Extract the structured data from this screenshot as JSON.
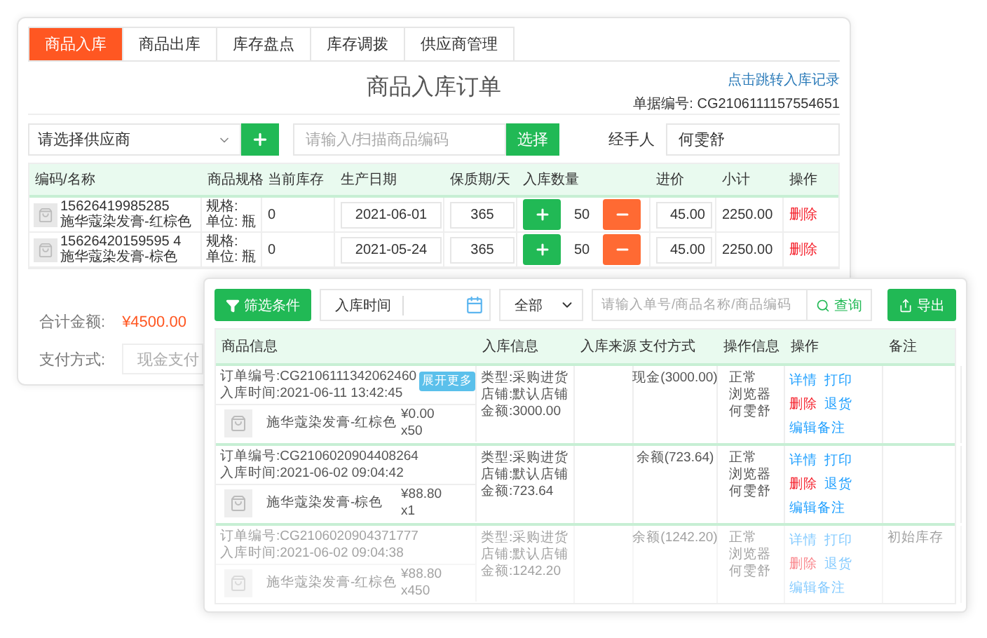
{
  "inbound_panel": {
    "tabs": [
      {
        "label": "商品入库",
        "selected": true
      },
      {
        "label": "商品出库",
        "selected": false
      },
      {
        "label": "库存盘点",
        "selected": false
      },
      {
        "label": "库存调拨",
        "selected": false
      },
      {
        "label": "供应商管理",
        "selected": false
      }
    ],
    "title": "商品入库订单",
    "record_link": "点击跳转入库记录",
    "order_no": "单据编号: CG2106111157554651",
    "supplier_select": "请选择供应商",
    "code_field": {
      "placeholder": "请输入/扫描商品编码"
    },
    "select_button": "选择",
    "handler_label": "经手人",
    "handler_value": "何雯舒",
    "columns": [
      "编码/名称",
      "商品规格",
      "当前库存",
      "生产日期",
      "保质期/天",
      "入库数量",
      "进价",
      "小计",
      "操作"
    ],
    "rows": [
      {
        "code": "15626419985285",
        "name": "施华蔻染发膏-红棕色",
        "spec": "规格:",
        "unit": "单位:  瓶",
        "stock": "0",
        "date": "2021-06-01",
        "shelf_life": "365",
        "quantity": "50",
        "price": "45.00",
        "subtotal": "2250.00",
        "action": "删除"
      },
      {
        "code": "15626420159595 4",
        "name": "施华蔻染发膏-棕色",
        "spec": "规格:",
        "unit": "单位:  瓶",
        "stock": "0",
        "date": "2021-05-24",
        "shelf_life": "365",
        "quantity": "50",
        "price": "45.00",
        "subtotal": "2250.00",
        "action": "删除"
      }
    ],
    "total_label": "合计金额:",
    "total": "¥4500.00",
    "payment_label": "支付方式:",
    "payment_value": "现金支付"
  },
  "records_panel": {
    "filter_button": "筛选条件",
    "date_label": "入库时间",
    "status_select": "全部",
    "search": {
      "placeholder": "请输入单号/商品名称/商品编码"
    },
    "query_button": "查询",
    "export_button": "导出",
    "columns": [
      "商品信息",
      "入库信息",
      "入库来源",
      "支付方式",
      "操作信息",
      "操作",
      "备注"
    ],
    "orders": [
      {
        "order_no": "订单编号:CG2106111342062460",
        "time": "入库时间:2021-06-11 13:42:45",
        "expand": "展开更多",
        "items": [
          {
            "name": "施华蔻染发膏-红棕色",
            "price": "¥0.00",
            "qty": "x50"
          }
        ],
        "type": "类型:采购进货",
        "store": "店铺:默认店铺",
        "amount": "金额:3000.00",
        "payment": "现金(3000.00)",
        "status": "正常",
        "device": "浏览器",
        "operator": "何雯舒",
        "actions": [
          {
            "label": "详情",
            "kind": "normal"
          },
          {
            "label": "打印",
            "kind": "normal"
          },
          {
            "label": "删除",
            "kind": "danger"
          },
          {
            "label": "退货",
            "kind": "normal"
          },
          {
            "label": "编辑备注",
            "kind": "normal"
          }
        ]
      },
      {
        "order_no": "订单编号:CG2106020904408264",
        "time": "入库时间:2021-06-02 09:04:42",
        "items": [
          {
            "name": "施华蔻染发膏-棕色",
            "price": "¥88.80",
            "qty": "x1"
          }
        ],
        "type": "类型:采购进货",
        "store": "店铺:默认店铺",
        "amount": "金额:723.64",
        "payment": "余额(723.64)",
        "status": "正常",
        "device": "浏览器",
        "operator": "何雯舒",
        "actions": [
          {
            "label": "详情",
            "kind": "normal"
          },
          {
            "label": "打印",
            "kind": "normal"
          },
          {
            "label": "删除",
            "kind": "danger"
          },
          {
            "label": "退货",
            "kind": "normal"
          },
          {
            "label": "编辑备注",
            "kind": "normal"
          }
        ]
      },
      {
        "order_no": "订单编号:CG2106020904371777",
        "time": "入库时间:2021-06-02 09:04:38",
        "items": [
          {
            "name": "施华蔻染发膏-红棕色",
            "price": "¥88.80",
            "qty": "x450"
          }
        ],
        "type": "类型:采购进货",
        "store": "店铺:默认店铺",
        "amount": "金额:1242.20",
        "payment": "余额(1242.20)",
        "status": "正常",
        "device": "浏览器",
        "operator": "何雯舒",
        "note": "初始库存",
        "actions": [
          {
            "label": "详情",
            "kind": "normal"
          },
          {
            "label": "打印",
            "kind": "normal"
          },
          {
            "label": "删除",
            "kind": "danger"
          },
          {
            "label": "退货",
            "kind": "normal"
          },
          {
            "label": "编辑备注",
            "kind": "normal"
          }
        ]
      }
    ]
  }
}
